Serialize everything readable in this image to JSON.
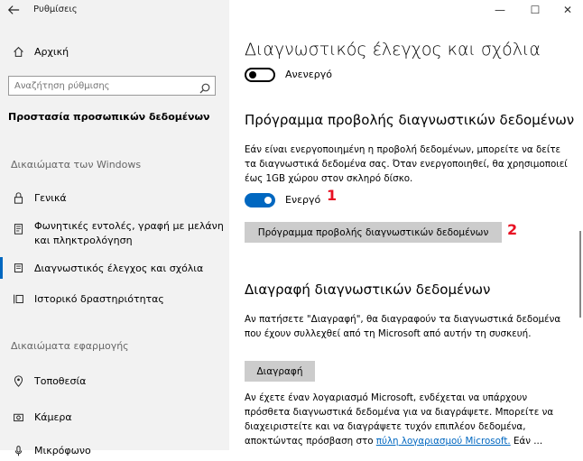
{
  "app": {
    "title": "Ρυθμίσεις"
  },
  "sidebar": {
    "home_label": "Αρχική",
    "search_placeholder": "Αναζήτηση ρύθμισης",
    "privacy_heading": "Προστασία προσωπικών δεδομένων",
    "windows_perms_heading": "Δικαιώματα των Windows",
    "app_perms_heading": "Δικαιώματα εφαρμογής",
    "items": [
      {
        "label": "Γενικά",
        "icon": "lock-icon"
      },
      {
        "label": "Φωνητικές εντολές, γραφή με μελάνη και πληκτρολόγηση",
        "icon": "notepad-icon"
      },
      {
        "label": "Διαγνωστικός έλεγχος και σχόλια",
        "icon": "feedback-icon",
        "selected": true
      },
      {
        "label": "Ιστορικό δραστηριότητας",
        "icon": "timeline-icon"
      }
    ],
    "app_items": [
      {
        "label": "Τοποθεσία",
        "icon": "location-icon"
      },
      {
        "label": "Κάμερα",
        "icon": "camera-icon"
      },
      {
        "label": "Μικρόφωνο",
        "icon": "microphone-icon"
      }
    ]
  },
  "window_controls": {
    "minimize": "—",
    "maximize": "☐",
    "close": "✕"
  },
  "main": {
    "title": "Διαγνωστικός έλεγχος και σχόλια",
    "top_toggle_label": "Ανενεργό",
    "viewer": {
      "heading": "Πρόγραμμα προβολής διαγνωστικών δεδομένων",
      "description": "Εάν είναι ενεργοποιημένη η προβολή δεδομένων, μπορείτε να δείτε τα διαγνωστικά δεδομένα σας. Όταν ενεργοποιηθεί, θα χρησιμοποιεί έως 1GB χώρου στον σκληρό δίσκο.",
      "toggle_label": "Ενεργό",
      "button_label": "Πρόγραμμα προβολής διαγνωστικών δεδομένων",
      "marker_1": "1",
      "marker_2": "2"
    },
    "delete": {
      "heading": "Διαγραφή διαγνωστικών δεδομένων",
      "description": "Αν πατήσετε \"Διαγραφή\", θα διαγραφούν τα διαγνωστικά δεδομένα που έχουν συλλεχθεί από τη Microsoft από αυτήν τη συσκευή.",
      "button_label": "Διαγραφή",
      "account_text": "Αν έχετε έναν λογαριασμό Microsoft, ενδέχεται να υπάρχουν πρόσθετα διαγνωστικά δεδομένα για να διαγράψετε. Μπορείτε να διαχειριστείτε και να διαγράψετε τυχόν επιπλέον δεδομένα, αποκτώντας πρόσβαση στο",
      "account_link": "πύλη λογαριασμού Microsoft.",
      "account_tail": "Εάν ..."
    }
  },
  "colors": {
    "accent": "#0067c0",
    "marker": "#e81123",
    "sidebar_bg": "#f2f2f2"
  }
}
